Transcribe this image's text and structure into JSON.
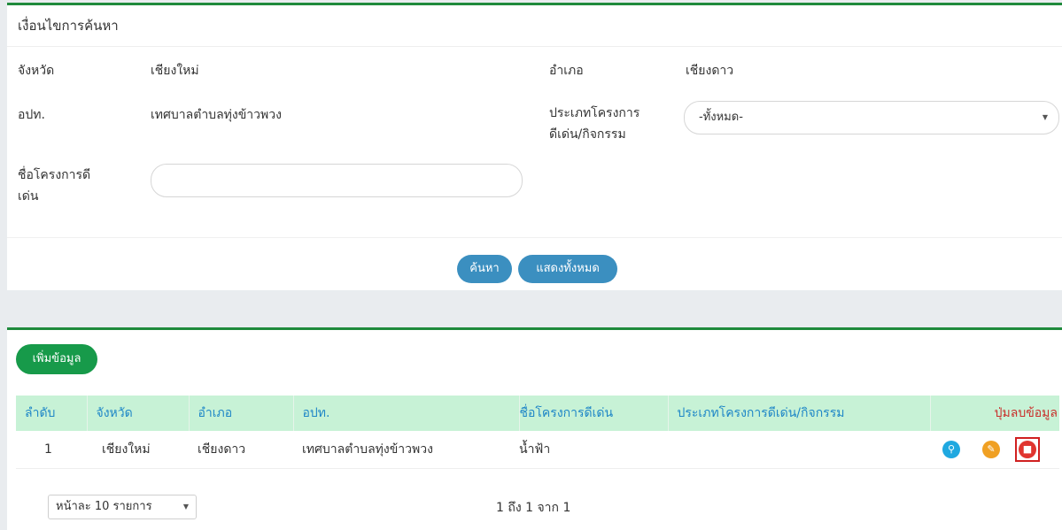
{
  "search": {
    "header": "เงื่อนไขการค้นหา",
    "province_label": "จังหวัด",
    "province_value": "เชียงใหม่",
    "district_label": "อำเภอ",
    "district_value": "เชียงดาว",
    "lao_label": "อปท.",
    "lao_value": "เทศบาลตำบลทุ่งข้าวพวง",
    "type_label_line1": "ประเภทโครงการ",
    "type_label_line2": "ดีเด่น/กิจกรรม",
    "type_select_value": "-ทั้งหมด-",
    "project_label_line1": "ชื่อโครงการดี",
    "project_label_line2": "เด่น",
    "project_input_value": "",
    "search_button": "ค้นหา",
    "show_all_button": "แสดงทั้งหมด"
  },
  "results": {
    "add_button": "เพิ่มข้อมูล",
    "columns": [
      "ลำดับ",
      "จังหวัด",
      "อำเภอ",
      "อปท.",
      "ชื่อโครงการดีเด่น",
      "ประเภทโครงการดีเด่น/กิจกรรม",
      "ปุ่มลบข้อมูล"
    ],
    "rows": [
      {
        "no": "1",
        "province": "เชียงใหม่",
        "district": "เชียงดาว",
        "lao": "เทศบาลตำบลทุ่งข้าวพวง",
        "project": "น้ำฟ้า",
        "type": ""
      }
    ],
    "page_size_select": "หน้าละ 10 รายการ",
    "pagination_info": "1 ถึง 1 จาก 1"
  },
  "colors": {
    "accent_green": "#1f8a3c",
    "button_blue": "#3b8fc0",
    "header_row_bg": "#c7f2d6",
    "header_text_blue": "#1e86c7",
    "delete_red": "#c9302c"
  },
  "icons": {
    "view": "search-icon",
    "edit": "edit-icon",
    "delete": "trash-icon",
    "select_caret": "caret-down-icon"
  }
}
